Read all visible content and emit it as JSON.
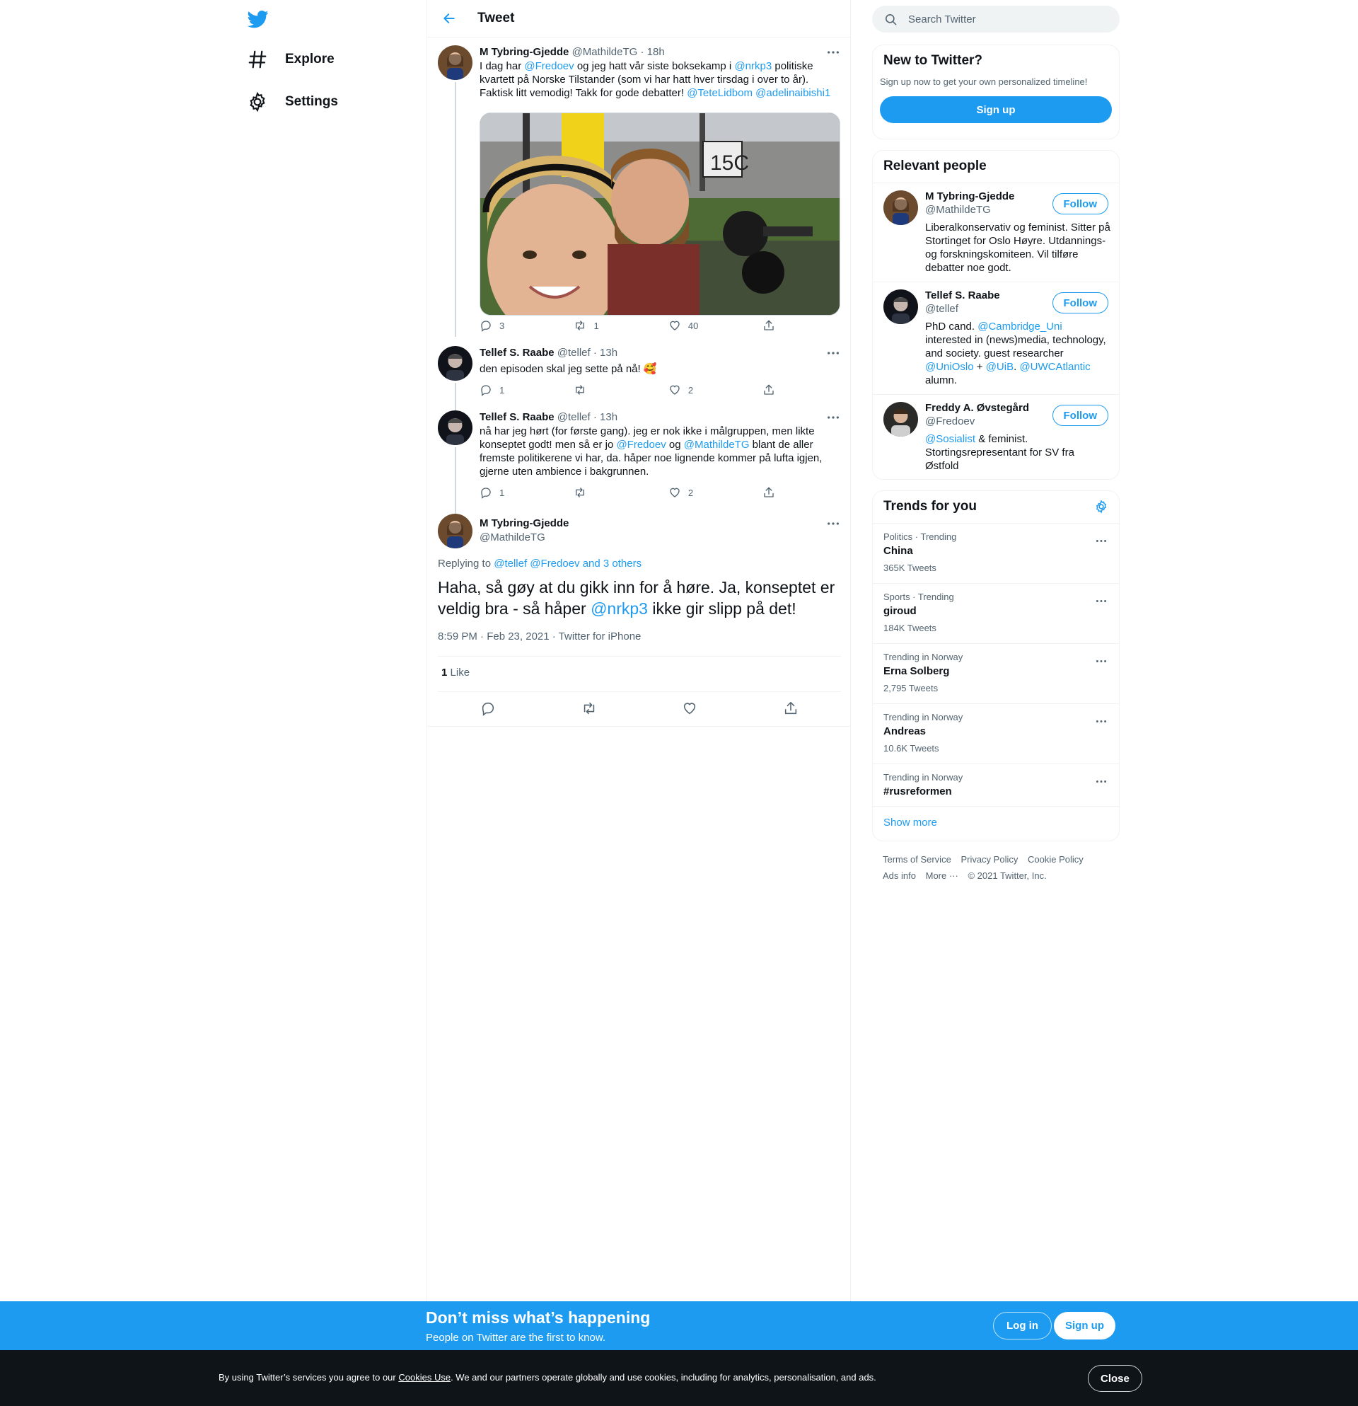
{
  "nav": {
    "logo": "twitter-bird-icon",
    "items": [
      {
        "label": "Explore",
        "icon": "hashtag-icon"
      },
      {
        "label": "Settings",
        "icon": "gear-icon"
      }
    ]
  },
  "main": {
    "title": "Tweet",
    "tweets": [
      {
        "name": "M Tybring-Gjedde",
        "handle": "@MathildeTG",
        "time": "18h",
        "text_parts": [
          "I dag har ",
          "@Fredoev",
          " og jeg hatt vår siste boksekamp i ",
          "@nrkp3",
          " politiske kvartett på Norske Tilstander (som vi har hatt hver tirsdag i over to år). Faktisk litt vemodig! Takk for gode debatter! ",
          "@TeteLidbom",
          " ",
          "@adelinaibishi1"
        ],
        "replies": "3",
        "retweets": "1",
        "likes": "40"
      },
      {
        "name": "Tellef S. Raabe",
        "handle": "@tellef",
        "time": "13h",
        "text": "den episoden skal jeg sette på nå! 🥰",
        "replies": "1",
        "retweets": "",
        "likes": "2"
      },
      {
        "name": "Tellef S. Raabe",
        "handle": "@tellef",
        "time": "13h",
        "text_parts": [
          "nå har jeg hørt (for første gang). jeg er nok ikke i målgruppen, men likte konseptet godt! men så er jo ",
          "@Fredoev",
          " og ",
          "@MathildeTG",
          " blant de aller fremste politikerene vi har, da. håper noe lignende kommer på lufta igjen, gjerne uten ambience i bakgrunnen."
        ],
        "replies": "1",
        "retweets": "",
        "likes": "2"
      }
    ],
    "focus": {
      "name": "M Tybring-Gjedde",
      "handle": "@MathildeTG",
      "replying_prefix": "Replying to ",
      "replying_links": "@tellef @Fredoev and 3 others",
      "text_parts": [
        "Haha, så gøy at du gikk inn for å høre. Ja, konseptet er veldig bra - så håper ",
        "@nrkp3",
        " ikke gir slipp på det!"
      ],
      "timestamp": "8:59 PM · Feb 23, 2021 · Twitter for iPhone",
      "like_count": "1",
      "like_label": "Like"
    }
  },
  "sidebar": {
    "search_placeholder": "Search Twitter",
    "new_card": {
      "title": "New to Twitter?",
      "subtitle": "Sign up now to get your own personalized timeline!",
      "button": "Sign up"
    },
    "relevant": {
      "title": "Relevant people",
      "follow_label": "Follow",
      "people": [
        {
          "name": "M Tybring-Gjedde",
          "handle": "@MathildeTG",
          "bio_parts": [
            "Liberalkonservativ og feminist. Sitter på Stortinget for Oslo Høyre. Utdannings- og forskningskomiteen. Vil tilføre debatter noe godt."
          ]
        },
        {
          "name": "Tellef S. Raabe",
          "handle": "@tellef",
          "bio_parts": [
            "PhD cand. ",
            "@Cambridge_Uni",
            " interested in (news)media, technology, and society. guest researcher ",
            "@UniOslo",
            " + ",
            "@UiB",
            ". ",
            "@UWCAtlantic",
            " alumn."
          ]
        },
        {
          "name": "Freddy A. Øvstegård",
          "handle": "@Fredoev",
          "bio_parts": [
            "@Sosialist",
            " & feminist. Stortingsrepresentant for SV fra Østfold"
          ]
        }
      ]
    },
    "trends": {
      "title": "Trends for you",
      "items": [
        {
          "context": "Politics · Trending",
          "name": "China",
          "count": "365K Tweets"
        },
        {
          "context": "Sports · Trending",
          "name": "giroud",
          "count": "184K Tweets"
        },
        {
          "context": "Trending in Norway",
          "name": "Erna Solberg",
          "count": "2,795 Tweets"
        },
        {
          "context": "Trending in Norway",
          "name": "Andreas",
          "count": "10.6K Tweets"
        },
        {
          "context": "Trending in Norway",
          "name": "#rusreformen",
          "count": ""
        }
      ],
      "show_more": "Show more"
    },
    "footer": {
      "links": [
        "Terms of Service",
        "Privacy Policy",
        "Cookie Policy",
        "Ads info",
        "More ···"
      ],
      "copyright": "© 2021 Twitter, Inc."
    }
  },
  "banner": {
    "title": "Don’t miss what’s happening",
    "subtitle": "People on Twitter are the first to know.",
    "login": "Log in",
    "signup": "Sign up"
  },
  "cookie": {
    "prefix": "By using Twitter’s services you agree to our ",
    "link": "Cookies Use",
    "suffix": ". We and our partners operate globally and use cookies, including for analytics, personalisation, and ads.",
    "close": "Close"
  },
  "colors": {
    "accent": "#1d9bf0",
    "text": "#0f1419",
    "muted": "#536471",
    "cookie_bg": "#0f1419"
  }
}
